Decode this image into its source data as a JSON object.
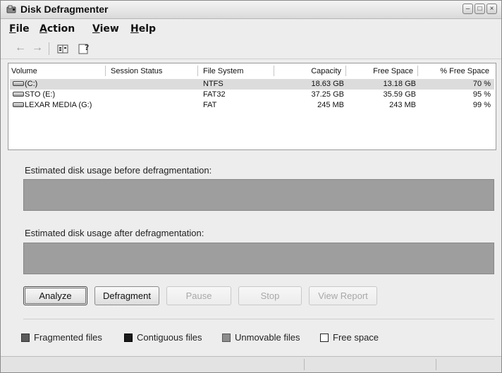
{
  "window": {
    "title": "Disk Defragmenter"
  },
  "menu": [
    {
      "mnemonic": "F",
      "rest": "ile"
    },
    {
      "mnemonic": "A",
      "rest": "ction"
    },
    {
      "mnemonic": "V",
      "rest": "iew"
    },
    {
      "mnemonic": "H",
      "rest": "elp"
    }
  ],
  "columns": [
    "Volume",
    "Session Status",
    "File System",
    "Capacity",
    "Free Space",
    "% Free Space"
  ],
  "volumes": [
    {
      "volume": "(C:)",
      "status": "",
      "fs": "NTFS",
      "capacity": "18.63 GB",
      "free": "13.18 GB",
      "pct": "70 %",
      "selected": true
    },
    {
      "volume": "STO (E:)",
      "status": "",
      "fs": "FAT32",
      "capacity": "37.25 GB",
      "free": "35.59 GB",
      "pct": "95 %",
      "selected": false
    },
    {
      "volume": "LEXAR MEDIA (G:)",
      "status": "",
      "fs": "FAT",
      "capacity": "245 MB",
      "free": "243 MB",
      "pct": "99 %",
      "selected": false
    }
  ],
  "labels": {
    "before": "Estimated disk usage before defragmentation:",
    "after": "Estimated disk usage after defragmentation:"
  },
  "buttons": {
    "analyze": "Analyze",
    "defragment": "Defragment",
    "pause": "Pause",
    "stop": "Stop",
    "view_report": "View Report"
  },
  "legend": {
    "fragmented": "Fragmented files",
    "contiguous": "Contiguous files",
    "unmovable": "Unmovable files",
    "free": "Free space"
  },
  "colors": {
    "fragmented": "#5a5a5a",
    "contiguous": "#1a1a1a",
    "unmovable": "#8c8c8c",
    "free": "#ffffff",
    "usage_bar": "#9e9e9e"
  },
  "icons": {
    "app": "disk-defragmenter-icon",
    "back": "back-arrow-icon",
    "forward": "forward-arrow-icon",
    "properties": "properties-icon",
    "help": "help-icon",
    "drive": "drive-icon"
  }
}
